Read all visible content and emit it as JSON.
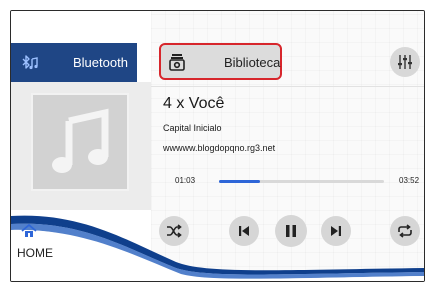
{
  "sidebar": {
    "bluetooth_label": "Bluetooth",
    "home_label": "HOME"
  },
  "header": {
    "library_label": "Biblioteca"
  },
  "track": {
    "title": "4 x Você",
    "artist": "Capital Inicialo",
    "album": "wwwww.blogdopqno.rg3.net",
    "elapsed": "01:03",
    "total": "03:52",
    "progress": 0.25
  },
  "colors": {
    "accent_blue": "#1f4685",
    "progress_blue": "#2e66d8",
    "highlight_red": "#d7262c"
  },
  "icons": {
    "bluetooth": "bluetooth-music-icon",
    "library": "library-icon",
    "equalizer": "equalizer-icon",
    "home": "home-icon",
    "shuffle": "shuffle-icon",
    "previous": "skip-previous-icon",
    "pause": "pause-icon",
    "next": "skip-next-icon",
    "repeat": "repeat-icon"
  }
}
